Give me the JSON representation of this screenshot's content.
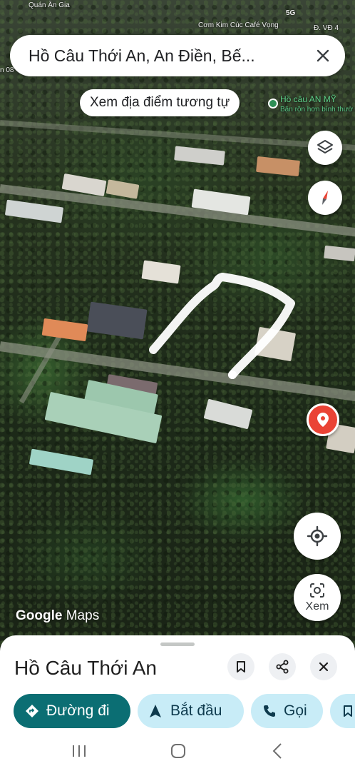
{
  "status_bar": {
    "top_left_label": "Quán Ăn Gia",
    "top_right_label": "Cơm Kim Cúc Café Vọng",
    "road_label": "Đ. VĐ 4",
    "left_edge_label": "n 08",
    "network": "5G"
  },
  "search": {
    "query": "Hồ Câu Thới An, An Điền, Bế..."
  },
  "similar_chip": {
    "label": "Xem địa điểm tương tự"
  },
  "nearby_poi": {
    "name": "Hồ câu AN MỸ",
    "subtitle": "Bận rộn hơn bình thườ"
  },
  "map_controls": {
    "layers_icon": "layers-icon",
    "compass_icon": "compass-icon",
    "my_location_icon": "my-location-icon",
    "lens_label": "Xem"
  },
  "branding": {
    "google": "Google",
    "maps": "Maps"
  },
  "sheet": {
    "title": "Hồ Câu Thới An",
    "actions": [
      {
        "label": "Đường đi",
        "icon": "directions-icon"
      },
      {
        "label": "Bắt đầu",
        "icon": "navigate-icon"
      },
      {
        "label": "Gọi",
        "icon": "phone-icon"
      }
    ]
  },
  "colors": {
    "primary": "#0b6e73",
    "secondary": "#c8ecf7",
    "pin": "#ea4335"
  }
}
